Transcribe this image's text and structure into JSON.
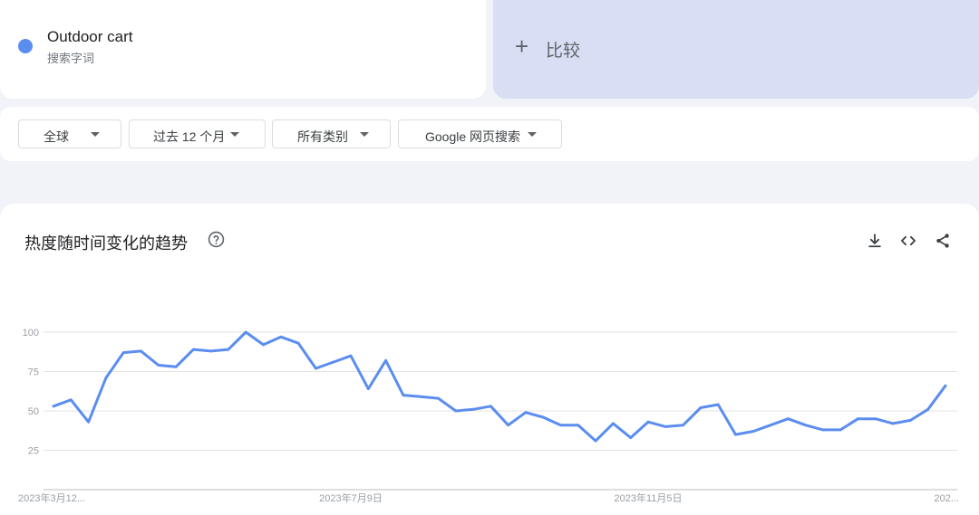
{
  "search_term": {
    "name": "Outdoor cart",
    "type": "搜索字词",
    "color": "#5b8def"
  },
  "compare": {
    "plus": "+",
    "label": "比较"
  },
  "filters": {
    "region": "全球",
    "time": "过去 12 个月",
    "category": "所有类别",
    "search_type": "Google 网页搜索"
  },
  "chart_section": {
    "title": "热度随时间变化的趋势",
    "icons": [
      "help-icon",
      "download-icon",
      "embed-icon",
      "share-icon"
    ]
  },
  "chart_data": {
    "type": "line",
    "ylim": [
      0,
      100
    ],
    "y_ticks": [
      25,
      50,
      75,
      100
    ],
    "x_tick_labels": [
      "2023年3月12...",
      "2023年7月9日",
      "2023年11月5日",
      "202..."
    ],
    "x_tick_index": [
      0,
      17,
      34,
      51
    ],
    "grid": true,
    "series": [
      {
        "color": "#5b8def",
        "values": [
          53,
          57,
          43,
          71,
          87,
          88,
          79,
          78,
          89,
          88,
          89,
          100,
          92,
          97,
          93,
          77,
          81,
          85,
          64,
          82,
          60,
          59,
          58,
          50,
          51,
          53,
          41,
          49,
          46,
          41,
          41,
          31,
          42,
          33,
          43,
          40,
          41,
          52,
          54,
          35,
          37,
          41,
          45,
          41,
          38,
          38,
          45,
          45,
          42,
          44,
          51,
          66
        ]
      }
    ]
  }
}
